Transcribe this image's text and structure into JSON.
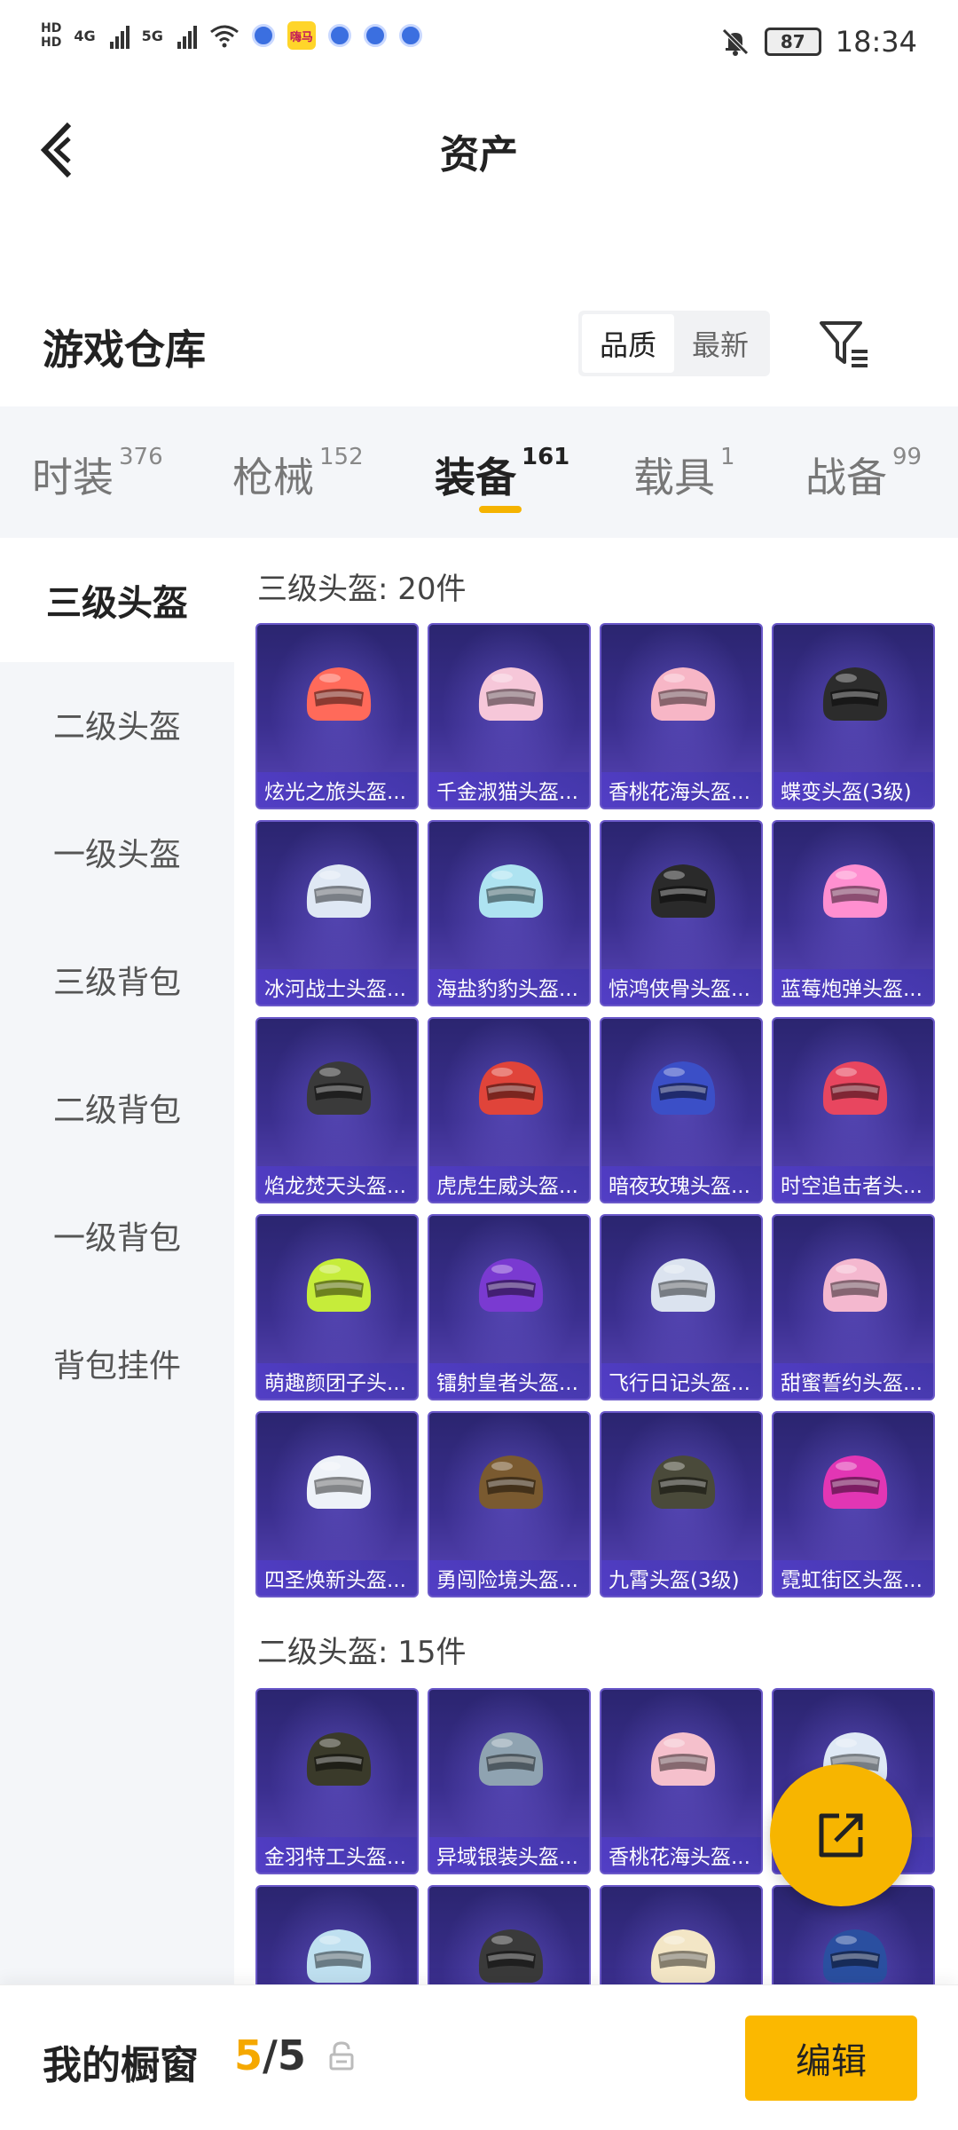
{
  "status_bar": {
    "hd_top": "HD",
    "hd_bottom": "HD",
    "network1": "4G",
    "network2": "5G",
    "app_badge": "嗨马",
    "battery": "87",
    "time": "18:34"
  },
  "header": {
    "title": "资产"
  },
  "warehouse": {
    "title": "游戏仓库",
    "sort_options": [
      "品质",
      "最新"
    ],
    "active_sort": "品质"
  },
  "tabs": [
    {
      "label": "时装",
      "count": "376"
    },
    {
      "label": "枪械",
      "count": "152"
    },
    {
      "label": "装备",
      "count": "161"
    },
    {
      "label": "载具",
      "count": "1"
    },
    {
      "label": "战备",
      "count": "99"
    }
  ],
  "active_tab": "装备",
  "left_nav": [
    "三级头盔",
    "二级头盔",
    "一级头盔",
    "三级背包",
    "二级背包",
    "一级背包",
    "背包挂件"
  ],
  "sections": [
    {
      "title": "三级头盔: 20件",
      "items": [
        "炫光之旅头盔...",
        "千金淑猫头盔...",
        "香桃花海头盔...",
        "蝶变头盔(3级)",
        "冰河战士头盔...",
        "海盐豹豹头盔...",
        "惊鸿侠骨头盔...",
        "蓝莓炮弹头盔...",
        "焰龙焚天头盔...",
        "虎虎生威头盔...",
        "暗夜玫瑰头盔...",
        "时空追击者头...",
        "萌趣颜团子头...",
        "镭射皇者头盔...",
        "飞行日记头盔...",
        "甜蜜誓约头盔...",
        "四圣焕新头盔...",
        "勇闯险境头盔...",
        "九霄头盔(3级)",
        "霓虹街区头盔..."
      ]
    },
    {
      "title": "二级头盔: 15件",
      "items": [
        "金羽特工头盔...",
        "异域银装头盔...",
        "香桃花海头盔...",
        "",
        "",
        "",
        "",
        ""
      ]
    }
  ],
  "bottom_bar": {
    "label": "我的橱窗",
    "current": "5",
    "separator": "/",
    "total": "5",
    "edit_label": "编辑"
  },
  "colors": {
    "accent": "#f7b500",
    "card_bg": "#3b2f8f",
    "card_border": "#6a58c9",
    "tab_bg": "#f4f6f9"
  },
  "helmet_colors": [
    "#ff6a5a",
    "#f6c7d9",
    "#f7b6c6",
    "#2c2c2c",
    "#dfe8f4",
    "#aee3f1",
    "#2a2a2a",
    "#ff8fd0",
    "#3a3a3a",
    "#e0443a",
    "#3b4fc7",
    "#e8465f",
    "#c6ec3a",
    "#7a3ad1",
    "#dbe3ef",
    "#f4b8cf",
    "#eef2f8",
    "#7a5a30",
    "#4a4a3a",
    "#e236b4",
    "#3a3a2a",
    "#8fa3b1",
    "#f5c0cc",
    "#dfe9f5",
    "#bfe0f0",
    "#3a3a3a",
    "#f3e6c6",
    "#2a4fa0"
  ]
}
